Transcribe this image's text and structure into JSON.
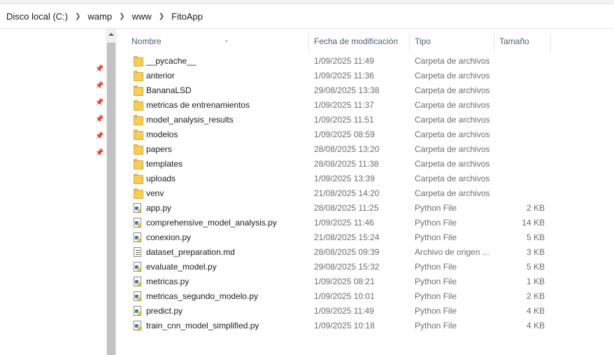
{
  "breadcrumb": [
    "Disco local (C:)",
    "wamp",
    "www",
    "FitoApp"
  ],
  "columns": {
    "name": "Nombre",
    "date": "Fecha de modificación",
    "type": "Tipo",
    "size": "Tamaño"
  },
  "files": [
    {
      "name": "__pycache__",
      "date": "1/09/2025 11:49",
      "type": "Carpeta de archivos",
      "size": "",
      "icon": "folder-icon"
    },
    {
      "name": "anterior",
      "date": "1/09/2025 11:36",
      "type": "Carpeta de archivos",
      "size": "",
      "icon": "folder-icon"
    },
    {
      "name": "BananaLSD",
      "date": "29/08/2025 13:38",
      "type": "Carpeta de archivos",
      "size": "",
      "icon": "folder-icon"
    },
    {
      "name": "metricas de entrenamientos",
      "date": "1/09/2025 11:37",
      "type": "Carpeta de archivos",
      "size": "",
      "icon": "folder-icon"
    },
    {
      "name": "model_analysis_results",
      "date": "1/09/2025 11:51",
      "type": "Carpeta de archivos",
      "size": "",
      "icon": "folder-icon"
    },
    {
      "name": "modelos",
      "date": "1/09/2025 08:59",
      "type": "Carpeta de archivos",
      "size": "",
      "icon": "folder-icon"
    },
    {
      "name": "papers",
      "date": "28/08/2025 13:20",
      "type": "Carpeta de archivos",
      "size": "",
      "icon": "folder-icon"
    },
    {
      "name": "templates",
      "date": "28/08/2025 11:38",
      "type": "Carpeta de archivos",
      "size": "",
      "icon": "folder-icon"
    },
    {
      "name": "uploads",
      "date": "1/09/2025 13:39",
      "type": "Carpeta de archivos",
      "size": "",
      "icon": "folder-icon"
    },
    {
      "name": "venv",
      "date": "21/08/2025 14:20",
      "type": "Carpeta de archivos",
      "size": "",
      "icon": "folder-icon"
    },
    {
      "name": "app.py",
      "date": "28/08/2025 11:25",
      "type": "Python File",
      "size": "2 KB",
      "icon": "python-file-icon"
    },
    {
      "name": "comprehensive_model_analysis.py",
      "date": "1/09/2025 11:46",
      "type": "Python File",
      "size": "14 KB",
      "icon": "python-file-icon"
    },
    {
      "name": "conexion.py",
      "date": "21/08/2025 15:24",
      "type": "Python File",
      "size": "5 KB",
      "icon": "python-file-icon"
    },
    {
      "name": "dataset_preparation.md",
      "date": "28/08/2025 09:39",
      "type": "Archivo de origen ...",
      "size": "3 KB",
      "icon": "markdown-file-icon"
    },
    {
      "name": "evaluate_model.py",
      "date": "29/08/2025 15:32",
      "type": "Python File",
      "size": "5 KB",
      "icon": "python-file-icon"
    },
    {
      "name": "metricas.py",
      "date": "1/09/2025 08:21",
      "type": "Python File",
      "size": "1 KB",
      "icon": "python-file-icon"
    },
    {
      "name": "metricas_segundo_modelo.py",
      "date": "1/09/2025 10:01",
      "type": "Python File",
      "size": "2 KB",
      "icon": "python-file-icon"
    },
    {
      "name": "predict.py",
      "date": "1/09/2025 11:49",
      "type": "Python File",
      "size": "4 KB",
      "icon": "python-file-icon"
    },
    {
      "name": "train_cnn_model_simplified.py",
      "date": "1/09/2025 10:18",
      "type": "Python File",
      "size": "4 KB",
      "icon": "python-file-icon"
    }
  ]
}
